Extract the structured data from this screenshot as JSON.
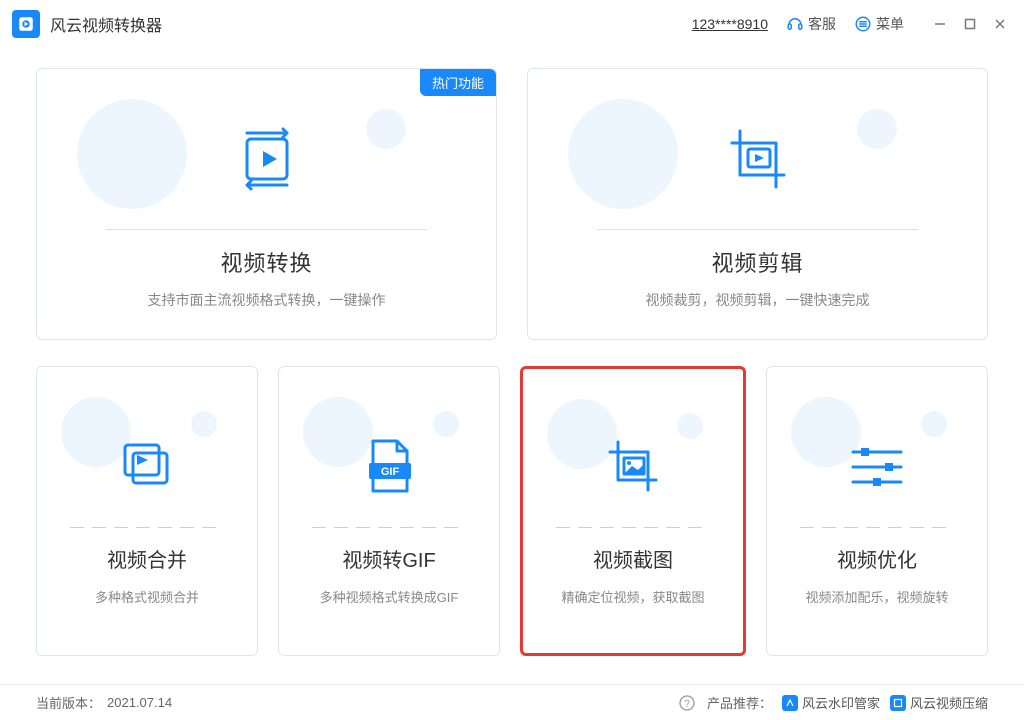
{
  "app": {
    "title": "风云视频转换器"
  },
  "header": {
    "user_id": "123****8910",
    "support": "客服",
    "menu": "菜单"
  },
  "cards": {
    "convert": {
      "title": "视频转换",
      "desc": "支持市面主流视频格式转换，一键操作",
      "badge": "热门功能"
    },
    "edit": {
      "title": "视频剪辑",
      "desc": "视频裁剪，视频剪辑，一键快速完成"
    },
    "merge": {
      "title": "视频合并",
      "desc": "多种格式视频合并"
    },
    "gif": {
      "title": "视频转GIF",
      "desc": "多种视频格式转换成GIF",
      "gif_label": "GIF"
    },
    "capture": {
      "title": "视频截图",
      "desc": "精确定位视频，获取截图"
    },
    "optimize": {
      "title": "视频优化",
      "desc": "视频添加配乐，视频旋转"
    }
  },
  "footer": {
    "version_label": "当前版本：",
    "version_value": "2021.07.14",
    "recommend_label": "产品推荐：",
    "rec1": "风云水印管家",
    "rec2": "风云视频压缩"
  }
}
